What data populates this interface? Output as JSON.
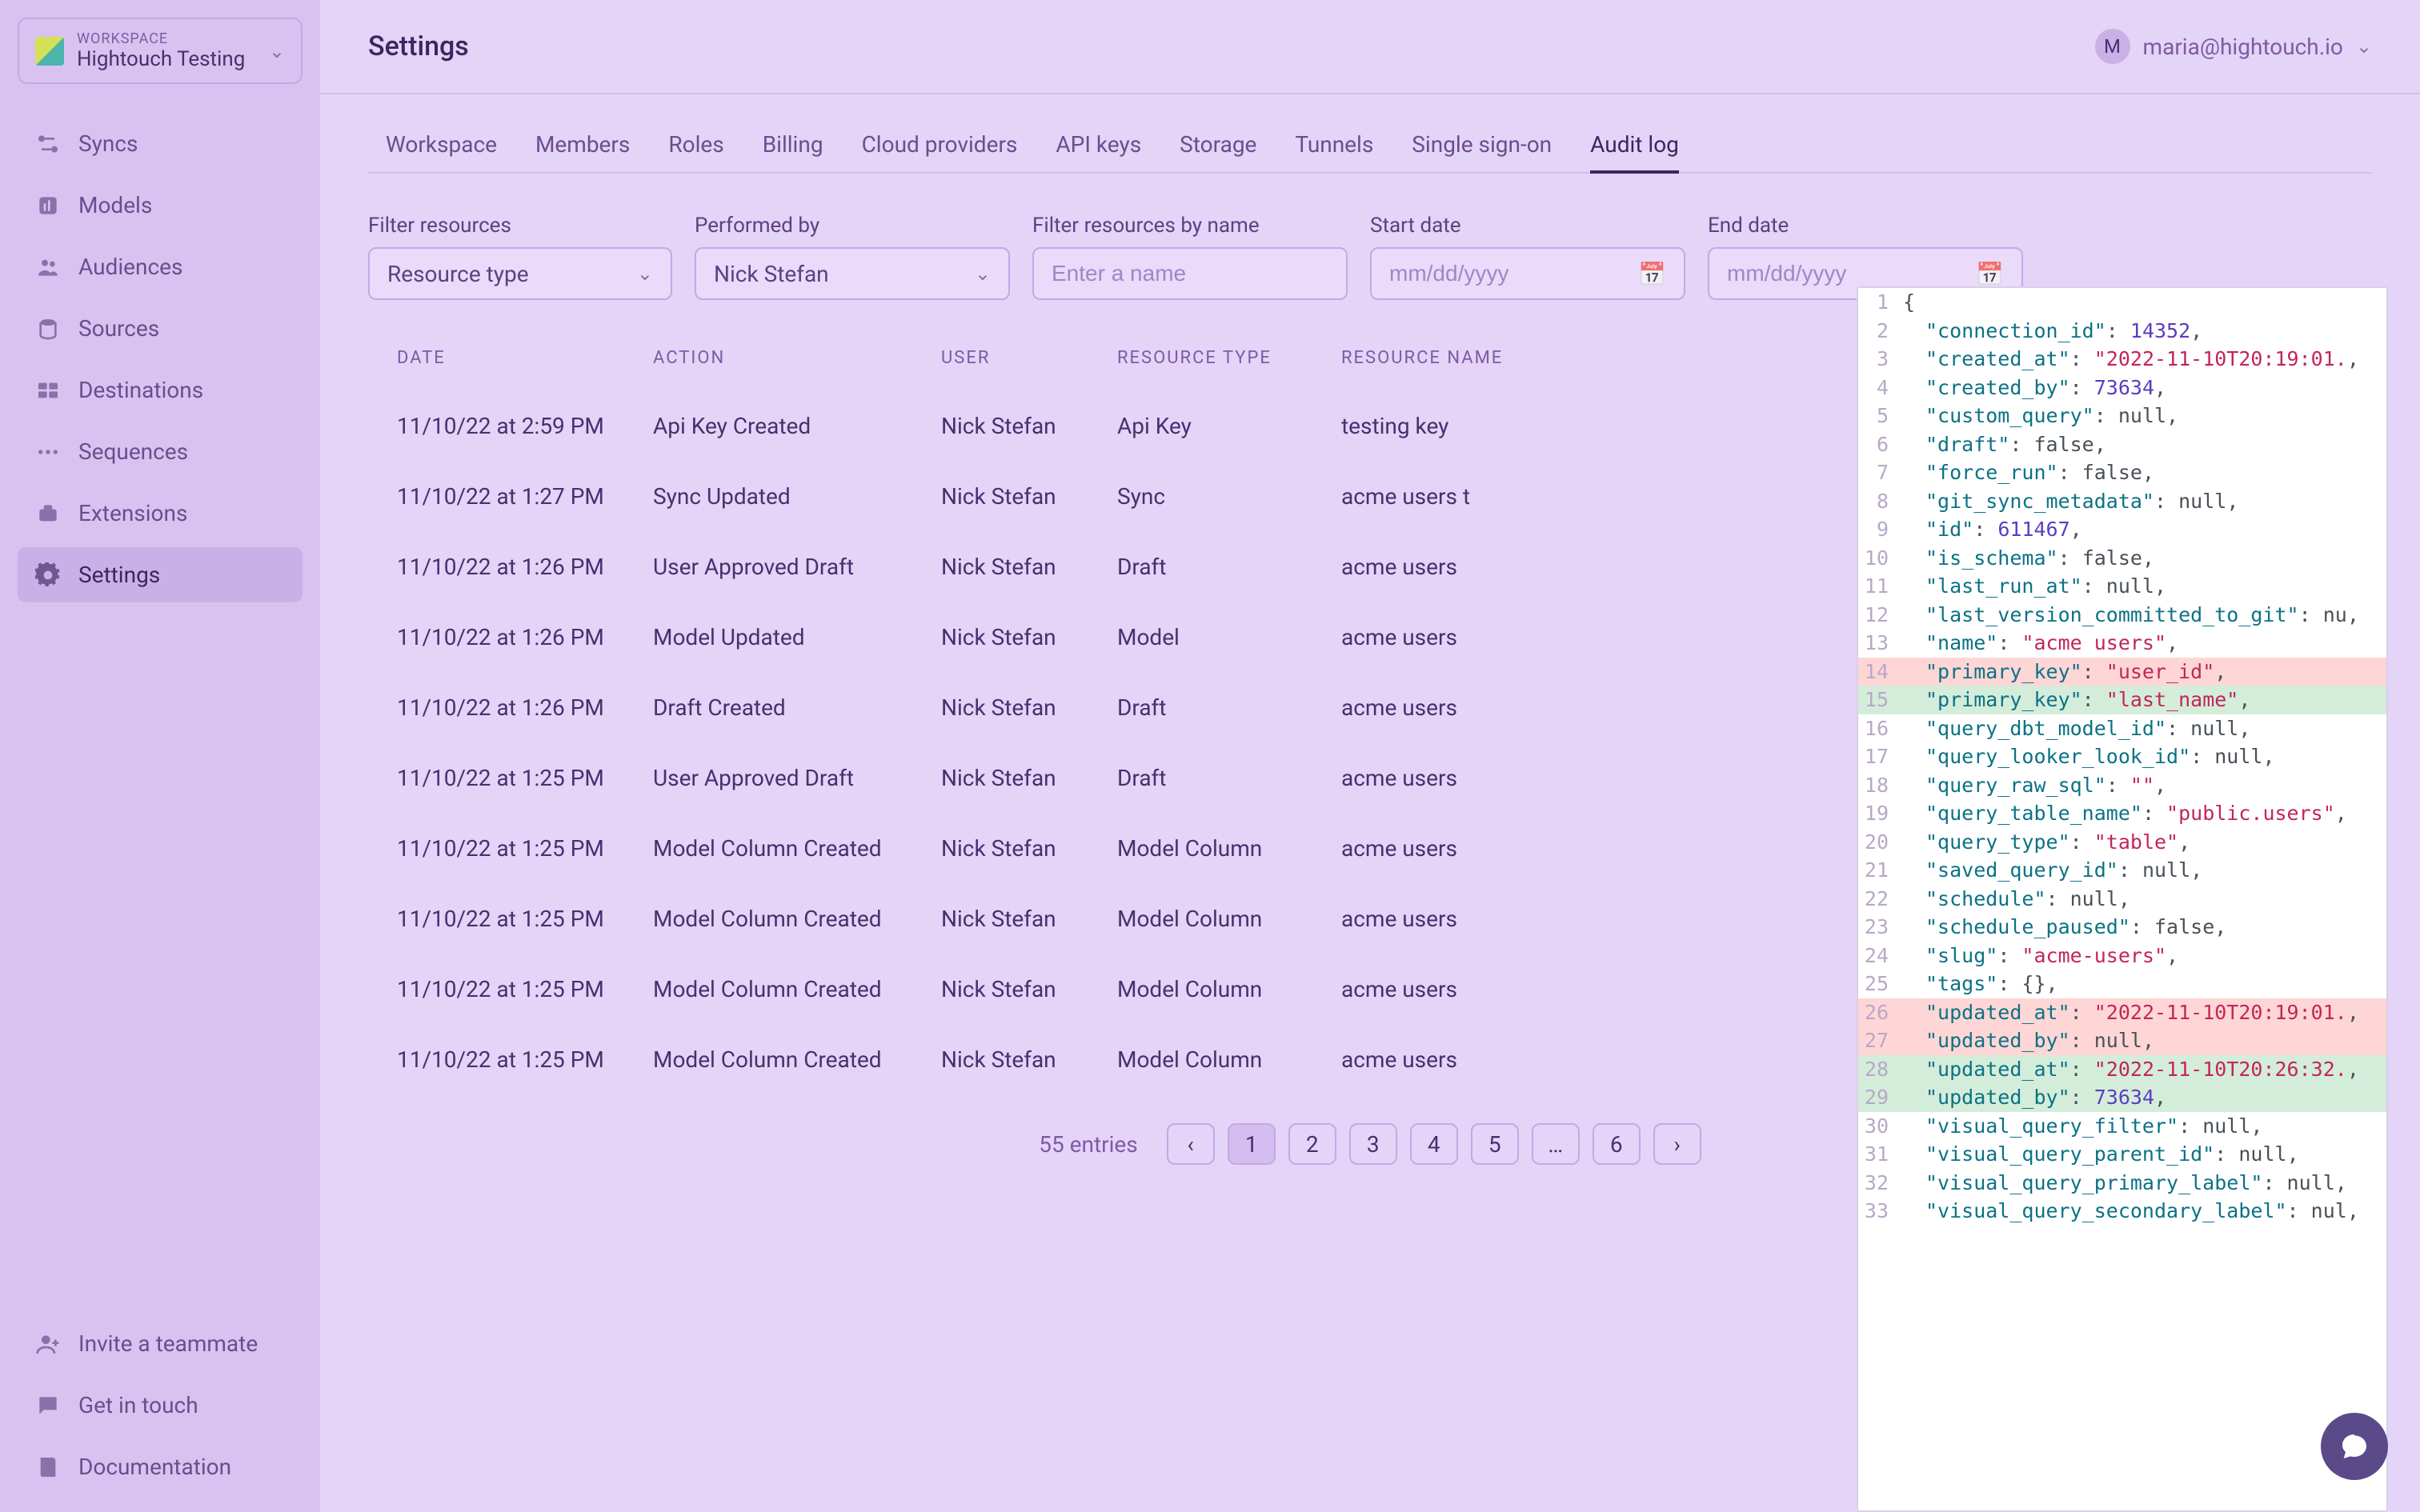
{
  "workspace": {
    "label": "WORKSPACE",
    "name": "Hightouch Testing"
  },
  "nav": {
    "items": [
      {
        "label": "Syncs"
      },
      {
        "label": "Models"
      },
      {
        "label": "Audiences"
      },
      {
        "label": "Sources"
      },
      {
        "label": "Destinations"
      },
      {
        "label": "Sequences"
      },
      {
        "label": "Extensions"
      },
      {
        "label": "Settings"
      }
    ],
    "bottom": [
      {
        "label": "Invite a teammate"
      },
      {
        "label": "Get in touch"
      },
      {
        "label": "Documentation"
      }
    ]
  },
  "header": {
    "title": "Settings",
    "user_initial": "M",
    "user_email": "maria@hightouch.io"
  },
  "tabs": [
    "Workspace",
    "Members",
    "Roles",
    "Billing",
    "Cloud providers",
    "API keys",
    "Storage",
    "Tunnels",
    "Single sign-on",
    "Audit log"
  ],
  "active_tab": "Audit log",
  "filters": {
    "resource_label": "Filter resources",
    "resource_value": "Resource type",
    "performed_by_label": "Performed by",
    "performed_by_value": "Nick Stefan",
    "name_label": "Filter resources by name",
    "name_placeholder": "Enter a name",
    "start_label": "Start date",
    "end_label": "End date",
    "date_placeholder": "mm/dd/yyyy"
  },
  "table": {
    "columns": [
      "DATE",
      "ACTION",
      "USER",
      "RESOURCE TYPE",
      "RESOURCE NAME"
    ],
    "rows": [
      {
        "date": "11/10/22 at 2:59 PM",
        "action": "Api Key Created",
        "user": "Nick Stefan",
        "type": "Api Key",
        "name": "testing key"
      },
      {
        "date": "11/10/22 at 1:27 PM",
        "action": "Sync Updated",
        "user": "Nick Stefan",
        "type": "Sync",
        "name": "acme users t"
      },
      {
        "date": "11/10/22 at 1:26 PM",
        "action": "User Approved Draft",
        "user": "Nick Stefan",
        "type": "Draft",
        "name": "acme users"
      },
      {
        "date": "11/10/22 at 1:26 PM",
        "action": "Model Updated",
        "user": "Nick Stefan",
        "type": "Model",
        "name": "acme users"
      },
      {
        "date": "11/10/22 at 1:26 PM",
        "action": "Draft Created",
        "user": "Nick Stefan",
        "type": "Draft",
        "name": "acme users"
      },
      {
        "date": "11/10/22 at 1:25 PM",
        "action": "User Approved Draft",
        "user": "Nick Stefan",
        "type": "Draft",
        "name": "acme users"
      },
      {
        "date": "11/10/22 at 1:25 PM",
        "action": "Model Column Created",
        "user": "Nick Stefan",
        "type": "Model Column",
        "name": "acme users"
      },
      {
        "date": "11/10/22 at 1:25 PM",
        "action": "Model Column Created",
        "user": "Nick Stefan",
        "type": "Model Column",
        "name": "acme users"
      },
      {
        "date": "11/10/22 at 1:25 PM",
        "action": "Model Column Created",
        "user": "Nick Stefan",
        "type": "Model Column",
        "name": "acme users"
      },
      {
        "date": "11/10/22 at 1:25 PM",
        "action": "Model Column Created",
        "user": "Nick Stefan",
        "type": "Model Column",
        "name": "acme users"
      }
    ]
  },
  "pagination": {
    "total_label": "55 entries",
    "pages": [
      "1",
      "2",
      "3",
      "4",
      "5",
      "…",
      "6"
    ],
    "active": "1"
  },
  "detail_json": {
    "lines": [
      {
        "n": 1,
        "raw": "{",
        "diff": ""
      },
      {
        "n": 2,
        "key": "connection_id",
        "val": "14352",
        "t": "num",
        "diff": ""
      },
      {
        "n": 3,
        "key": "created_at",
        "val": "\"2022-11-10T20:19:01.",
        "t": "str",
        "diff": ""
      },
      {
        "n": 4,
        "key": "created_by",
        "val": "73634",
        "t": "num",
        "diff": ""
      },
      {
        "n": 5,
        "key": "custom_query",
        "val": "null",
        "t": "kw",
        "diff": ""
      },
      {
        "n": 6,
        "key": "draft",
        "val": "false",
        "t": "kw",
        "diff": ""
      },
      {
        "n": 7,
        "key": "force_run",
        "val": "false",
        "t": "kw",
        "diff": ""
      },
      {
        "n": 8,
        "key": "git_sync_metadata",
        "val": "null",
        "t": "kw",
        "diff": ""
      },
      {
        "n": 9,
        "key": "id",
        "val": "611467",
        "t": "num",
        "diff": ""
      },
      {
        "n": 10,
        "key": "is_schema",
        "val": "false",
        "t": "kw",
        "diff": ""
      },
      {
        "n": 11,
        "key": "last_run_at",
        "val": "null",
        "t": "kw",
        "diff": ""
      },
      {
        "n": 12,
        "key": "last_version_committed_to_git",
        "val": "nu",
        "t": "kw",
        "diff": ""
      },
      {
        "n": 13,
        "key": "name",
        "val": "\"acme users\"",
        "t": "str",
        "diff": ""
      },
      {
        "n": 14,
        "key": "primary_key",
        "val": "\"user_id\"",
        "t": "str",
        "diff": "del"
      },
      {
        "n": 15,
        "key": "primary_key",
        "val": "\"last_name\"",
        "t": "str",
        "diff": "add"
      },
      {
        "n": 16,
        "key": "query_dbt_model_id",
        "val": "null",
        "t": "kw",
        "diff": ""
      },
      {
        "n": 17,
        "key": "query_looker_look_id",
        "val": "null",
        "t": "kw",
        "diff": ""
      },
      {
        "n": 18,
        "key": "query_raw_sql",
        "val": "\"\"",
        "t": "str",
        "diff": ""
      },
      {
        "n": 19,
        "key": "query_table_name",
        "val": "\"public.users\"",
        "t": "str",
        "diff": ""
      },
      {
        "n": 20,
        "key": "query_type",
        "val": "\"table\"",
        "t": "str",
        "diff": ""
      },
      {
        "n": 21,
        "key": "saved_query_id",
        "val": "null",
        "t": "kw",
        "diff": ""
      },
      {
        "n": 22,
        "key": "schedule",
        "val": "null",
        "t": "kw",
        "diff": ""
      },
      {
        "n": 23,
        "key": "schedule_paused",
        "val": "false",
        "t": "kw",
        "diff": ""
      },
      {
        "n": 24,
        "key": "slug",
        "val": "\"acme-users\"",
        "t": "str",
        "diff": ""
      },
      {
        "n": 25,
        "key": "tags",
        "val": "{}",
        "t": "kw",
        "diff": ""
      },
      {
        "n": 26,
        "key": "updated_at",
        "val": "\"2022-11-10T20:19:01.",
        "t": "str",
        "diff": "del"
      },
      {
        "n": 27,
        "key": "updated_by",
        "val": "null",
        "t": "kw",
        "diff": "del"
      },
      {
        "n": 28,
        "key": "updated_at",
        "val": "\"2022-11-10T20:26:32.",
        "t": "str",
        "diff": "add"
      },
      {
        "n": 29,
        "key": "updated_by",
        "val": "73634",
        "t": "num",
        "diff": "add"
      },
      {
        "n": 30,
        "key": "visual_query_filter",
        "val": "null",
        "t": "kw",
        "diff": ""
      },
      {
        "n": 31,
        "key": "visual_query_parent_id",
        "val": "null",
        "t": "kw",
        "diff": ""
      },
      {
        "n": 32,
        "key": "visual_query_primary_label",
        "val": "null",
        "t": "kw",
        "diff": ""
      },
      {
        "n": 33,
        "key": "visual_query_secondary_label",
        "val": "nul",
        "t": "kw",
        "diff": ""
      }
    ]
  }
}
